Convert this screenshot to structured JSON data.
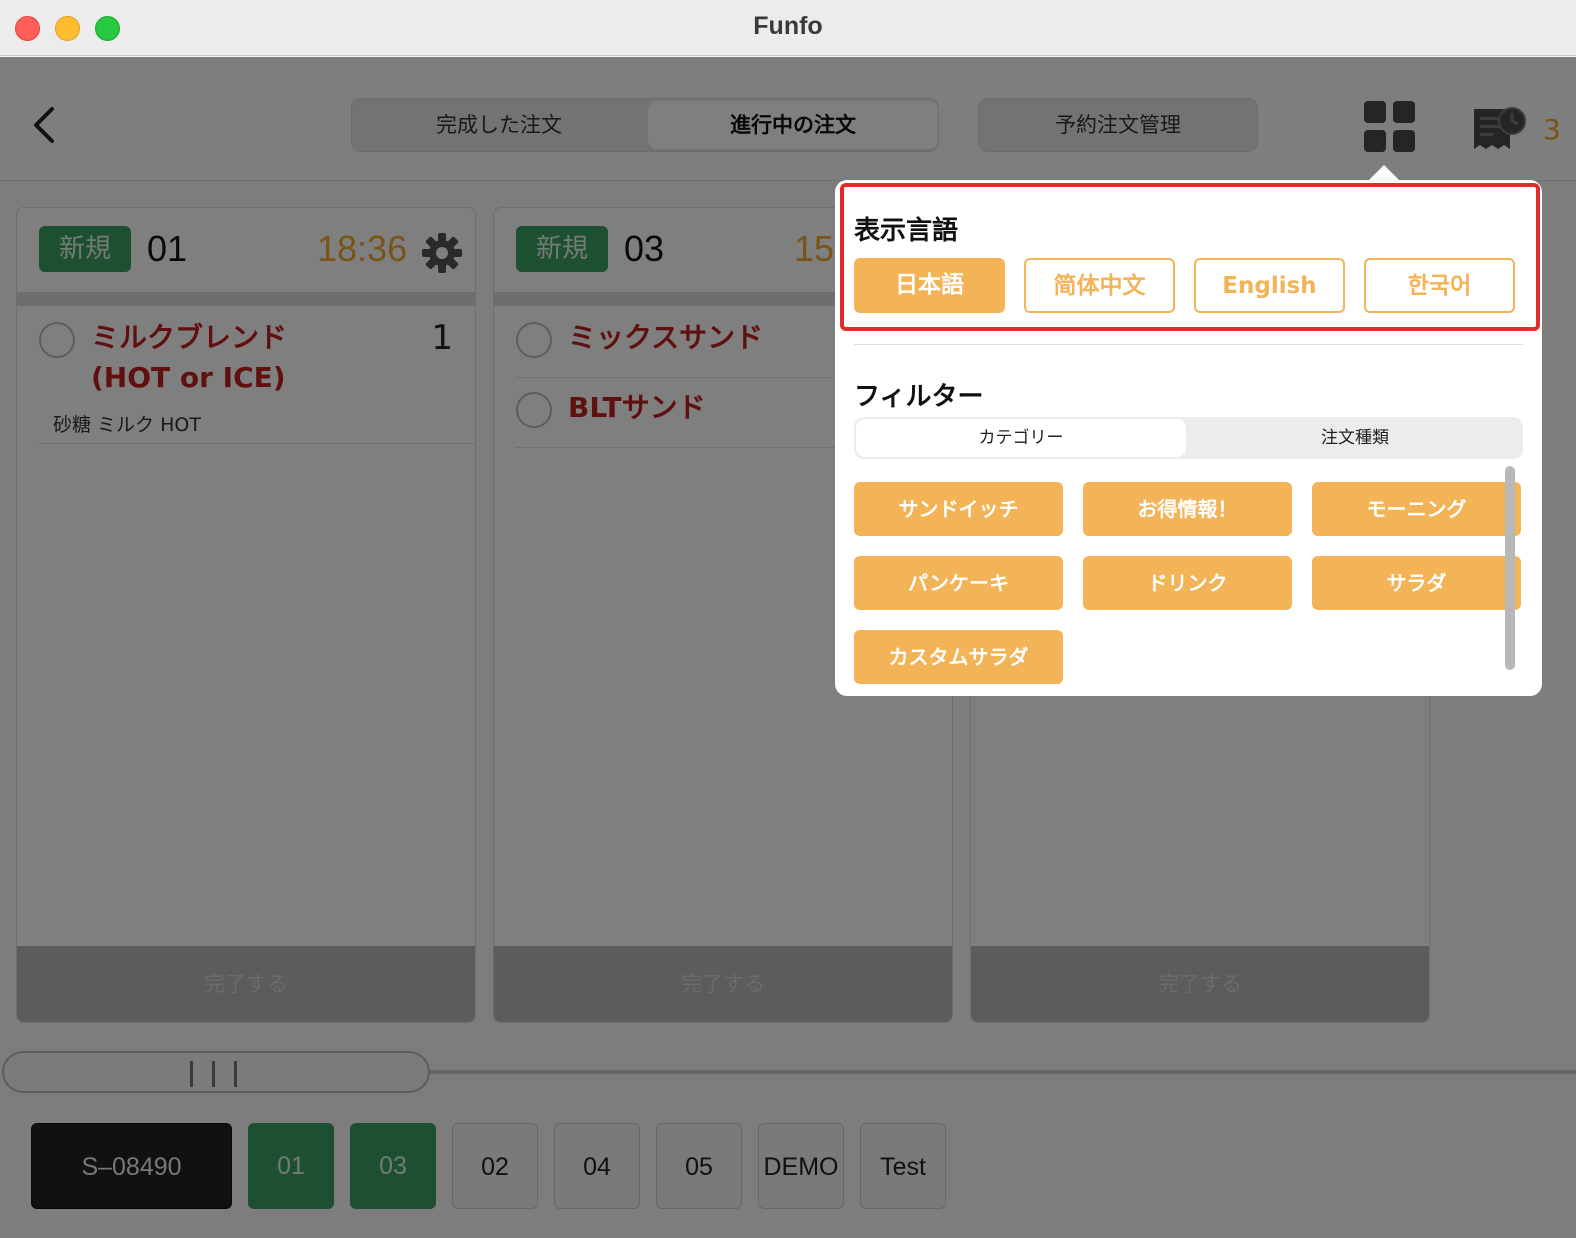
{
  "window": {
    "title": "Funfo"
  },
  "header": {
    "tabs": [
      {
        "label": "完成した注文",
        "active": false
      },
      {
        "label": "進行中の注文",
        "active": true
      }
    ],
    "reserve_label": "予約注文管理",
    "receipt_count": "3"
  },
  "orders": [
    {
      "status": "新規",
      "table": "01",
      "time": "18:36",
      "items": [
        {
          "name_line1": "ミルクブレンド",
          "name_line2": "(HOT or ICE)",
          "qty": "1",
          "options": "砂糖 ミルク HOT"
        }
      ],
      "complete_label": "完了する"
    },
    {
      "status": "新規",
      "table": "03",
      "time": "15",
      "items": [
        {
          "name_line1": "ミックスサンド"
        },
        {
          "name_line1": "BLTサンド"
        }
      ],
      "complete_label": "完了する"
    },
    {
      "complete_label": "完了する"
    }
  ],
  "tables": [
    "S–08490",
    "01",
    "03",
    "02",
    "04",
    "05",
    "DEMO",
    "Test"
  ],
  "popover": {
    "language_title": "表示言語",
    "languages": [
      {
        "label": "日本語",
        "selected": true
      },
      {
        "label": "简体中文",
        "selected": false
      },
      {
        "label": "English",
        "selected": false
      },
      {
        "label": "한국어",
        "selected": false
      }
    ],
    "filter_title": "フィルター",
    "filter_tabs": [
      {
        "label": "カテゴリー",
        "active": true
      },
      {
        "label": "注文種類",
        "active": false
      }
    ],
    "categories": [
      "サンドイッチ",
      "お得情報！",
      "モーニング",
      "パンケーキ",
      "ドリンク",
      "サラダ",
      "カスタムサラダ"
    ]
  },
  "colors": {
    "accent": "#f3b357",
    "badge_green": "#3aa061",
    "item_red": "#c0231f",
    "highlight": "#e22b2b"
  }
}
